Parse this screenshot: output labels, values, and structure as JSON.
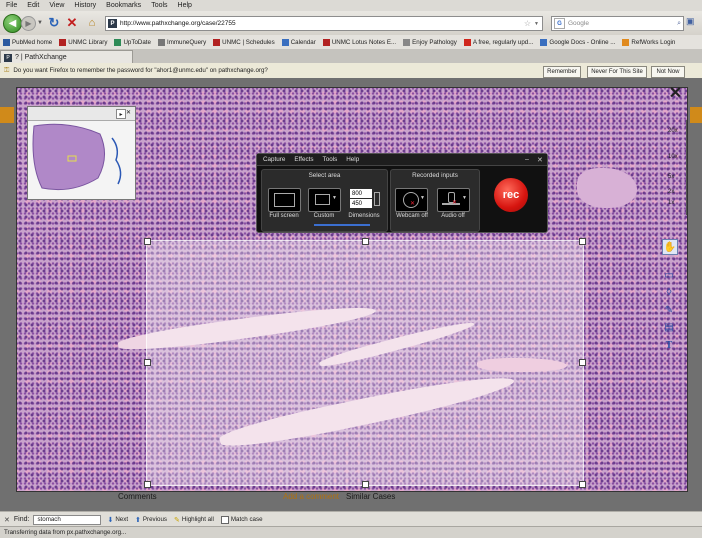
{
  "menu": [
    "File",
    "Edit",
    "View",
    "History",
    "Bookmarks",
    "Tools",
    "Help"
  ],
  "nav": {
    "url": "http://www.pathxchange.org/case/22755",
    "search_placeholder": "Google",
    "favicon": "P"
  },
  "bookmarks": [
    {
      "label": "PubMed home",
      "color": "#2c5aa0"
    },
    {
      "label": "UNMC Library",
      "color": "#b22222"
    },
    {
      "label": "UpToDate",
      "color": "#2e8b57"
    },
    {
      "label": "ImmuneQuery",
      "color": "#777777"
    },
    {
      "label": "UNMC | Schedules",
      "color": "#b22222"
    },
    {
      "label": "Calendar",
      "color": "#3a6fbf"
    },
    {
      "label": "UNMC Lotus Notes E...",
      "color": "#b22222"
    },
    {
      "label": "Enjoy Pathology",
      "color": "#888888"
    },
    {
      "label": "A free, regularly upd...",
      "color": "#d0271d"
    },
    {
      "label": "Google Docs - Online ...",
      "color": "#3a6fbf"
    },
    {
      "label": "RefWorks Login",
      "color": "#e08a1e"
    }
  ],
  "tab": {
    "label": "? | PathXchange",
    "icon": "P"
  },
  "password_bar": {
    "message": "Do you want Firefox to remember the password for \"ahor1@unmc.edu\" on pathxchange.org?",
    "buttons": [
      "Remember",
      "Never For This Site",
      "Not Now"
    ]
  },
  "viewer": {
    "zoom_levels": [
      "20x",
      "10x",
      "5x",
      "2x",
      "1x"
    ],
    "close": "✕"
  },
  "capture_toolbar": {
    "menu": [
      "Capture",
      "Effects",
      "Tools",
      "Help"
    ],
    "select_area_title": "Select area",
    "recorded_inputs_title": "Recorded inputs",
    "full_screen": "Full screen",
    "custom": "Custom",
    "dimensions": "Dimensions",
    "width": "800",
    "height": "450",
    "webcam": "Webcam off",
    "audio": "Audio off",
    "rec": "rec"
  },
  "page_links": {
    "comments": "Comments",
    "add_comment": "Add a comment",
    "similar": "Similar Cases"
  },
  "find": {
    "label": "Find:",
    "value": "stomach",
    "next": "Next",
    "previous": "Previous",
    "highlight": "Highlight all",
    "match_case": "Match case"
  },
  "status": "Transferring data from px.pathxchange.org..."
}
